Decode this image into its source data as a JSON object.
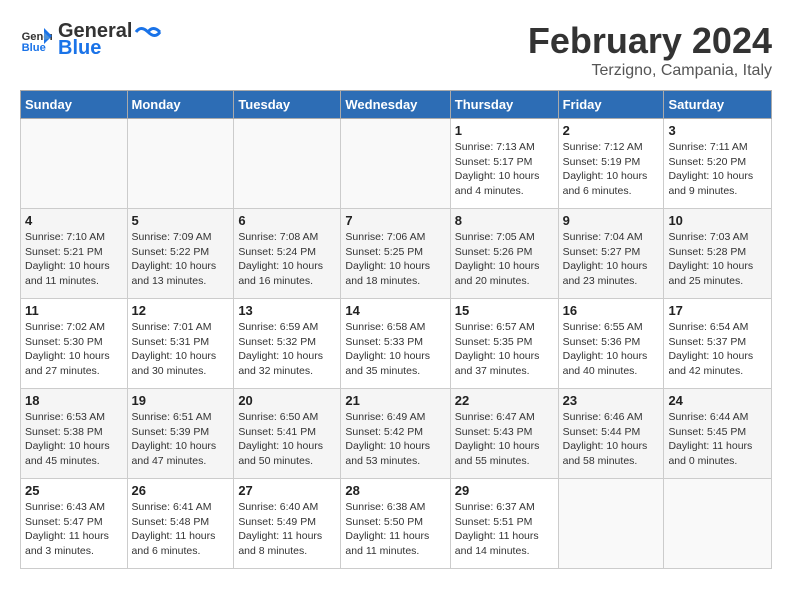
{
  "header": {
    "logo_general": "General",
    "logo_blue": "Blue",
    "month_year": "February 2024",
    "location": "Terzigno, Campania, Italy"
  },
  "weekdays": [
    "Sunday",
    "Monday",
    "Tuesday",
    "Wednesday",
    "Thursday",
    "Friday",
    "Saturday"
  ],
  "weeks": [
    [
      {
        "day": "",
        "info": ""
      },
      {
        "day": "",
        "info": ""
      },
      {
        "day": "",
        "info": ""
      },
      {
        "day": "",
        "info": ""
      },
      {
        "day": "1",
        "info": "Sunrise: 7:13 AM\nSunset: 5:17 PM\nDaylight: 10 hours\nand 4 minutes."
      },
      {
        "day": "2",
        "info": "Sunrise: 7:12 AM\nSunset: 5:19 PM\nDaylight: 10 hours\nand 6 minutes."
      },
      {
        "day": "3",
        "info": "Sunrise: 7:11 AM\nSunset: 5:20 PM\nDaylight: 10 hours\nand 9 minutes."
      }
    ],
    [
      {
        "day": "4",
        "info": "Sunrise: 7:10 AM\nSunset: 5:21 PM\nDaylight: 10 hours\nand 11 minutes."
      },
      {
        "day": "5",
        "info": "Sunrise: 7:09 AM\nSunset: 5:22 PM\nDaylight: 10 hours\nand 13 minutes."
      },
      {
        "day": "6",
        "info": "Sunrise: 7:08 AM\nSunset: 5:24 PM\nDaylight: 10 hours\nand 16 minutes."
      },
      {
        "day": "7",
        "info": "Sunrise: 7:06 AM\nSunset: 5:25 PM\nDaylight: 10 hours\nand 18 minutes."
      },
      {
        "day": "8",
        "info": "Sunrise: 7:05 AM\nSunset: 5:26 PM\nDaylight: 10 hours\nand 20 minutes."
      },
      {
        "day": "9",
        "info": "Sunrise: 7:04 AM\nSunset: 5:27 PM\nDaylight: 10 hours\nand 23 minutes."
      },
      {
        "day": "10",
        "info": "Sunrise: 7:03 AM\nSunset: 5:28 PM\nDaylight: 10 hours\nand 25 minutes."
      }
    ],
    [
      {
        "day": "11",
        "info": "Sunrise: 7:02 AM\nSunset: 5:30 PM\nDaylight: 10 hours\nand 27 minutes."
      },
      {
        "day": "12",
        "info": "Sunrise: 7:01 AM\nSunset: 5:31 PM\nDaylight: 10 hours\nand 30 minutes."
      },
      {
        "day": "13",
        "info": "Sunrise: 6:59 AM\nSunset: 5:32 PM\nDaylight: 10 hours\nand 32 minutes."
      },
      {
        "day": "14",
        "info": "Sunrise: 6:58 AM\nSunset: 5:33 PM\nDaylight: 10 hours\nand 35 minutes."
      },
      {
        "day": "15",
        "info": "Sunrise: 6:57 AM\nSunset: 5:35 PM\nDaylight: 10 hours\nand 37 minutes."
      },
      {
        "day": "16",
        "info": "Sunrise: 6:55 AM\nSunset: 5:36 PM\nDaylight: 10 hours\nand 40 minutes."
      },
      {
        "day": "17",
        "info": "Sunrise: 6:54 AM\nSunset: 5:37 PM\nDaylight: 10 hours\nand 42 minutes."
      }
    ],
    [
      {
        "day": "18",
        "info": "Sunrise: 6:53 AM\nSunset: 5:38 PM\nDaylight: 10 hours\nand 45 minutes."
      },
      {
        "day": "19",
        "info": "Sunrise: 6:51 AM\nSunset: 5:39 PM\nDaylight: 10 hours\nand 47 minutes."
      },
      {
        "day": "20",
        "info": "Sunrise: 6:50 AM\nSunset: 5:41 PM\nDaylight: 10 hours\nand 50 minutes."
      },
      {
        "day": "21",
        "info": "Sunrise: 6:49 AM\nSunset: 5:42 PM\nDaylight: 10 hours\nand 53 minutes."
      },
      {
        "day": "22",
        "info": "Sunrise: 6:47 AM\nSunset: 5:43 PM\nDaylight: 10 hours\nand 55 minutes."
      },
      {
        "day": "23",
        "info": "Sunrise: 6:46 AM\nSunset: 5:44 PM\nDaylight: 10 hours\nand 58 minutes."
      },
      {
        "day": "24",
        "info": "Sunrise: 6:44 AM\nSunset: 5:45 PM\nDaylight: 11 hours\nand 0 minutes."
      }
    ],
    [
      {
        "day": "25",
        "info": "Sunrise: 6:43 AM\nSunset: 5:47 PM\nDaylight: 11 hours\nand 3 minutes."
      },
      {
        "day": "26",
        "info": "Sunrise: 6:41 AM\nSunset: 5:48 PM\nDaylight: 11 hours\nand 6 minutes."
      },
      {
        "day": "27",
        "info": "Sunrise: 6:40 AM\nSunset: 5:49 PM\nDaylight: 11 hours\nand 8 minutes."
      },
      {
        "day": "28",
        "info": "Sunrise: 6:38 AM\nSunset: 5:50 PM\nDaylight: 11 hours\nand 11 minutes."
      },
      {
        "day": "29",
        "info": "Sunrise: 6:37 AM\nSunset: 5:51 PM\nDaylight: 11 hours\nand 14 minutes."
      },
      {
        "day": "",
        "info": ""
      },
      {
        "day": "",
        "info": ""
      }
    ]
  ]
}
